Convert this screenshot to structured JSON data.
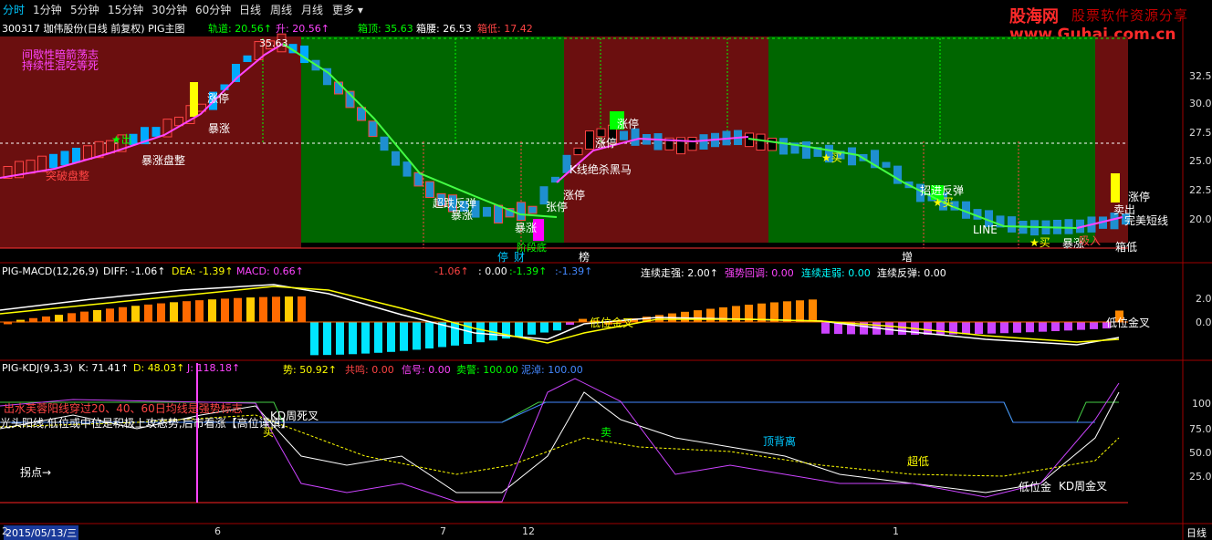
{
  "menu": {
    "tabs": [
      {
        "label": "分时",
        "active": true
      },
      {
        "label": "1分钟",
        "active": false
      },
      {
        "label": "5分钟",
        "active": false
      },
      {
        "label": "15分钟",
        "active": false
      },
      {
        "label": "30分钟",
        "active": false
      },
      {
        "label": "60分钟",
        "active": false
      },
      {
        "label": "日线",
        "active": false
      },
      {
        "label": "周线",
        "active": false
      },
      {
        "label": "月线",
        "active": false
      },
      {
        "label": "更多 ▾",
        "active": false
      }
    ]
  },
  "watermark": {
    "brand_cn": "股海网",
    "slogan": "股票软件资源分享",
    "url": "www.Guhai.com.cn"
  },
  "main_panel": {
    "title": "300317 珈伟股份(日线 前复权) PIG主图",
    "indicators": [
      {
        "label": "轨道:",
        "value": "20.56↑",
        "color": "#00ff00"
      },
      {
        "label": "升:",
        "value": "20.56↑",
        "color": "#ff44ff"
      },
      {
        "label": "箱顶:",
        "value": "35.63",
        "color": "#00ff00"
      },
      {
        "label": "箱腰:",
        "value": "26.53",
        "color": "#ffffff"
      },
      {
        "label": "箱低:",
        "value": "17.42",
        "color": "#ff4444"
      }
    ],
    "left_notes": [
      "间歇性暗箭荡志",
      "持续性混吃等死"
    ],
    "axis_ticks": [
      "32.5",
      "30.0",
      "27.5",
      "25.0",
      "22.5",
      "20.0"
    ],
    "high_label": "35.63",
    "box_bottom_label": "箱低",
    "annotations": [
      {
        "text": "突破盘整",
        "color": "#ff4444"
      },
      {
        "text": "暴涨盘整",
        "color": "#ffffff"
      },
      {
        "text": "★出",
        "color": "#00ff00"
      },
      {
        "text": "暴涨",
        "color": "#ffffff"
      },
      {
        "text": "涨停",
        "color": "#ffffff"
      },
      {
        "text": "超跌反弹",
        "color": "#ffffff"
      },
      {
        "text": "暴涨",
        "color": "#ffffff"
      },
      {
        "text": "暴涨",
        "color": "#ffffff"
      },
      {
        "text": "张停",
        "color": "#ffffff"
      },
      {
        "text": "涨停",
        "color": "#ffffff"
      },
      {
        "text": "涨停",
        "color": "#ffffff"
      },
      {
        "text": "K线绝杀黑马",
        "color": "#ffffff"
      },
      {
        "text": "涨停",
        "color": "#ffffff"
      },
      {
        "text": "出",
        "color": "#ffffff"
      },
      {
        "text": "★买",
        "color": "#ffff00"
      },
      {
        "text": "招进反弹",
        "color": "#ffffff"
      },
      {
        "text": "★买",
        "color": "#ffff00"
      },
      {
        "text": "LINE",
        "color": "#ffffff"
      },
      {
        "text": "★买",
        "color": "#ffff00"
      },
      {
        "text": "暴涨",
        "color": "#ffffff"
      },
      {
        "text": "卖出",
        "color": "#ffffff"
      },
      {
        "text": "涨停",
        "color": "#ffffff"
      },
      {
        "text": "完美短线",
        "color": "#ffffff"
      },
      {
        "text": "吸入",
        "color": "#ff4444"
      },
      {
        "text": "阶段底",
        "color": "#00ff00"
      }
    ],
    "bottom_tags": [
      {
        "text": "停",
        "color": "#00c8ff"
      },
      {
        "text": "财",
        "color": "#00c8ff"
      },
      {
        "text": "榜",
        "color": "#ffffff"
      },
      {
        "text": "增",
        "color": "#ffffff"
      }
    ]
  },
  "macd_panel": {
    "title": "PIG-MACD(12,26,9)",
    "items": [
      {
        "label": "DIFF:",
        "value": "-1.06↑",
        "color": "#ffffff"
      },
      {
        "label": "DEA:",
        "value": "-1.39↑",
        "color": "#ffff00"
      },
      {
        "label": "MACD:",
        "value": "0.66↑",
        "color": "#ff44ff"
      }
    ],
    "extra": [
      {
        "text": "-1.06↑",
        "color": "#ff4444"
      },
      {
        "text": ": 0.00",
        "color": "#ffffff"
      },
      {
        "text": ":-1.39↑",
        "color": "#00ff00"
      },
      {
        "text": ":-1.39↑",
        "color": "#4488ff"
      },
      {
        "text": "连续走强: 2.00↑",
        "color": "#ffffff"
      },
      {
        "text": "强势回调: 0.00",
        "color": "#ff44ff"
      },
      {
        "text": "连续走弱: 0.00",
        "color": "#00ffff"
      },
      {
        "text": "连续反弹: 0.00",
        "color": "#ffffff"
      }
    ],
    "axis_ticks": [
      "2.0",
      "0.0"
    ],
    "notes": [
      "低位金叉",
      "低位金叉"
    ]
  },
  "kdj_panel": {
    "title": "PIG-KDJ(9,3,3)",
    "items": [
      {
        "label": "K:",
        "value": "71.41↑",
        "color": "#ffffff"
      },
      {
        "label": "D:",
        "value": "48.03↑",
        "color": "#ffff00"
      },
      {
        "label": "J:",
        "value": "118.18↑",
        "color": "#ff44ff"
      }
    ],
    "extra": [
      {
        "text": "势: 50.92↑",
        "color": "#ffff00"
      },
      {
        "text": "共鸣: 0.00",
        "color": "#ff4444"
      },
      {
        "text": "信号: 0.00",
        "color": "#ff44ff"
      },
      {
        "text": "卖警: 100.00",
        "color": "#00ff00"
      },
      {
        "text": "泥淖: 100.00",
        "color": "#4488ff"
      }
    ],
    "axis_ticks": [
      "100",
      "75.0",
      "50.0",
      "25.0"
    ],
    "notes": [
      {
        "text": "出水芙蓉阳线穿过20、40、60日均线是强势标志",
        "color": "#ff4444"
      },
      {
        "text": "光头阳线,低位或中位是积极上攻态势,后市看涨【高位谨慎】",
        "color": "#ffffff"
      },
      {
        "text": "KD周死叉",
        "color": "#ffffff"
      },
      {
        "text": "买",
        "color": "#ffff00"
      },
      {
        "text": "拐点→",
        "color": "#ffffff"
      },
      {
        "text": "卖",
        "color": "#00ff00"
      },
      {
        "text": "顶背离",
        "color": "#00c8ff"
      },
      {
        "text": "超低",
        "color": "#ffff00"
      },
      {
        "text": "低位金",
        "color": "#ffffff"
      },
      {
        "text": "KD周金叉",
        "color": "#ffffff"
      }
    ]
  },
  "x_axis": {
    "date_label": "2015/05/13/三",
    "ticks": [
      "2",
      "6",
      "7",
      "12",
      "1"
    ],
    "period": "日线"
  }
}
